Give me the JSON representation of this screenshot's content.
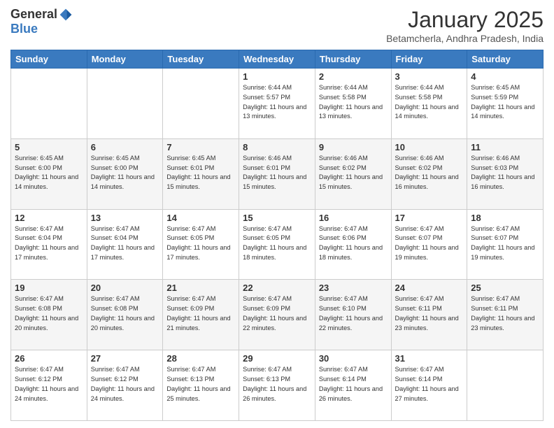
{
  "logo": {
    "general": "General",
    "blue": "Blue"
  },
  "header": {
    "title": "January 2025",
    "location": "Betamcherla, Andhra Pradesh, India"
  },
  "days_of_week": [
    "Sunday",
    "Monday",
    "Tuesday",
    "Wednesday",
    "Thursday",
    "Friday",
    "Saturday"
  ],
  "weeks": [
    [
      {
        "day": "",
        "sunrise": "",
        "sunset": "",
        "daylight": ""
      },
      {
        "day": "",
        "sunrise": "",
        "sunset": "",
        "daylight": ""
      },
      {
        "day": "",
        "sunrise": "",
        "sunset": "",
        "daylight": ""
      },
      {
        "day": "1",
        "sunrise": "Sunrise: 6:44 AM",
        "sunset": "Sunset: 5:57 PM",
        "daylight": "Daylight: 11 hours and 13 minutes."
      },
      {
        "day": "2",
        "sunrise": "Sunrise: 6:44 AM",
        "sunset": "Sunset: 5:58 PM",
        "daylight": "Daylight: 11 hours and 13 minutes."
      },
      {
        "day": "3",
        "sunrise": "Sunrise: 6:44 AM",
        "sunset": "Sunset: 5:58 PM",
        "daylight": "Daylight: 11 hours and 14 minutes."
      },
      {
        "day": "4",
        "sunrise": "Sunrise: 6:45 AM",
        "sunset": "Sunset: 5:59 PM",
        "daylight": "Daylight: 11 hours and 14 minutes."
      }
    ],
    [
      {
        "day": "5",
        "sunrise": "Sunrise: 6:45 AM",
        "sunset": "Sunset: 6:00 PM",
        "daylight": "Daylight: 11 hours and 14 minutes."
      },
      {
        "day": "6",
        "sunrise": "Sunrise: 6:45 AM",
        "sunset": "Sunset: 6:00 PM",
        "daylight": "Daylight: 11 hours and 14 minutes."
      },
      {
        "day": "7",
        "sunrise": "Sunrise: 6:45 AM",
        "sunset": "Sunset: 6:01 PM",
        "daylight": "Daylight: 11 hours and 15 minutes."
      },
      {
        "day": "8",
        "sunrise": "Sunrise: 6:46 AM",
        "sunset": "Sunset: 6:01 PM",
        "daylight": "Daylight: 11 hours and 15 minutes."
      },
      {
        "day": "9",
        "sunrise": "Sunrise: 6:46 AM",
        "sunset": "Sunset: 6:02 PM",
        "daylight": "Daylight: 11 hours and 15 minutes."
      },
      {
        "day": "10",
        "sunrise": "Sunrise: 6:46 AM",
        "sunset": "Sunset: 6:02 PM",
        "daylight": "Daylight: 11 hours and 16 minutes."
      },
      {
        "day": "11",
        "sunrise": "Sunrise: 6:46 AM",
        "sunset": "Sunset: 6:03 PM",
        "daylight": "Daylight: 11 hours and 16 minutes."
      }
    ],
    [
      {
        "day": "12",
        "sunrise": "Sunrise: 6:47 AM",
        "sunset": "Sunset: 6:04 PM",
        "daylight": "Daylight: 11 hours and 17 minutes."
      },
      {
        "day": "13",
        "sunrise": "Sunrise: 6:47 AM",
        "sunset": "Sunset: 6:04 PM",
        "daylight": "Daylight: 11 hours and 17 minutes."
      },
      {
        "day": "14",
        "sunrise": "Sunrise: 6:47 AM",
        "sunset": "Sunset: 6:05 PM",
        "daylight": "Daylight: 11 hours and 17 minutes."
      },
      {
        "day": "15",
        "sunrise": "Sunrise: 6:47 AM",
        "sunset": "Sunset: 6:05 PM",
        "daylight": "Daylight: 11 hours and 18 minutes."
      },
      {
        "day": "16",
        "sunrise": "Sunrise: 6:47 AM",
        "sunset": "Sunset: 6:06 PM",
        "daylight": "Daylight: 11 hours and 18 minutes."
      },
      {
        "day": "17",
        "sunrise": "Sunrise: 6:47 AM",
        "sunset": "Sunset: 6:07 PM",
        "daylight": "Daylight: 11 hours and 19 minutes."
      },
      {
        "day": "18",
        "sunrise": "Sunrise: 6:47 AM",
        "sunset": "Sunset: 6:07 PM",
        "daylight": "Daylight: 11 hours and 19 minutes."
      }
    ],
    [
      {
        "day": "19",
        "sunrise": "Sunrise: 6:47 AM",
        "sunset": "Sunset: 6:08 PM",
        "daylight": "Daylight: 11 hours and 20 minutes."
      },
      {
        "day": "20",
        "sunrise": "Sunrise: 6:47 AM",
        "sunset": "Sunset: 6:08 PM",
        "daylight": "Daylight: 11 hours and 20 minutes."
      },
      {
        "day": "21",
        "sunrise": "Sunrise: 6:47 AM",
        "sunset": "Sunset: 6:09 PM",
        "daylight": "Daylight: 11 hours and 21 minutes."
      },
      {
        "day": "22",
        "sunrise": "Sunrise: 6:47 AM",
        "sunset": "Sunset: 6:09 PM",
        "daylight": "Daylight: 11 hours and 22 minutes."
      },
      {
        "day": "23",
        "sunrise": "Sunrise: 6:47 AM",
        "sunset": "Sunset: 6:10 PM",
        "daylight": "Daylight: 11 hours and 22 minutes."
      },
      {
        "day": "24",
        "sunrise": "Sunrise: 6:47 AM",
        "sunset": "Sunset: 6:11 PM",
        "daylight": "Daylight: 11 hours and 23 minutes."
      },
      {
        "day": "25",
        "sunrise": "Sunrise: 6:47 AM",
        "sunset": "Sunset: 6:11 PM",
        "daylight": "Daylight: 11 hours and 23 minutes."
      }
    ],
    [
      {
        "day": "26",
        "sunrise": "Sunrise: 6:47 AM",
        "sunset": "Sunset: 6:12 PM",
        "daylight": "Daylight: 11 hours and 24 minutes."
      },
      {
        "day": "27",
        "sunrise": "Sunrise: 6:47 AM",
        "sunset": "Sunset: 6:12 PM",
        "daylight": "Daylight: 11 hours and 24 minutes."
      },
      {
        "day": "28",
        "sunrise": "Sunrise: 6:47 AM",
        "sunset": "Sunset: 6:13 PM",
        "daylight": "Daylight: 11 hours and 25 minutes."
      },
      {
        "day": "29",
        "sunrise": "Sunrise: 6:47 AM",
        "sunset": "Sunset: 6:13 PM",
        "daylight": "Daylight: 11 hours and 26 minutes."
      },
      {
        "day": "30",
        "sunrise": "Sunrise: 6:47 AM",
        "sunset": "Sunset: 6:14 PM",
        "daylight": "Daylight: 11 hours and 26 minutes."
      },
      {
        "day": "31",
        "sunrise": "Sunrise: 6:47 AM",
        "sunset": "Sunset: 6:14 PM",
        "daylight": "Daylight: 11 hours and 27 minutes."
      },
      {
        "day": "",
        "sunrise": "",
        "sunset": "",
        "daylight": ""
      }
    ]
  ]
}
